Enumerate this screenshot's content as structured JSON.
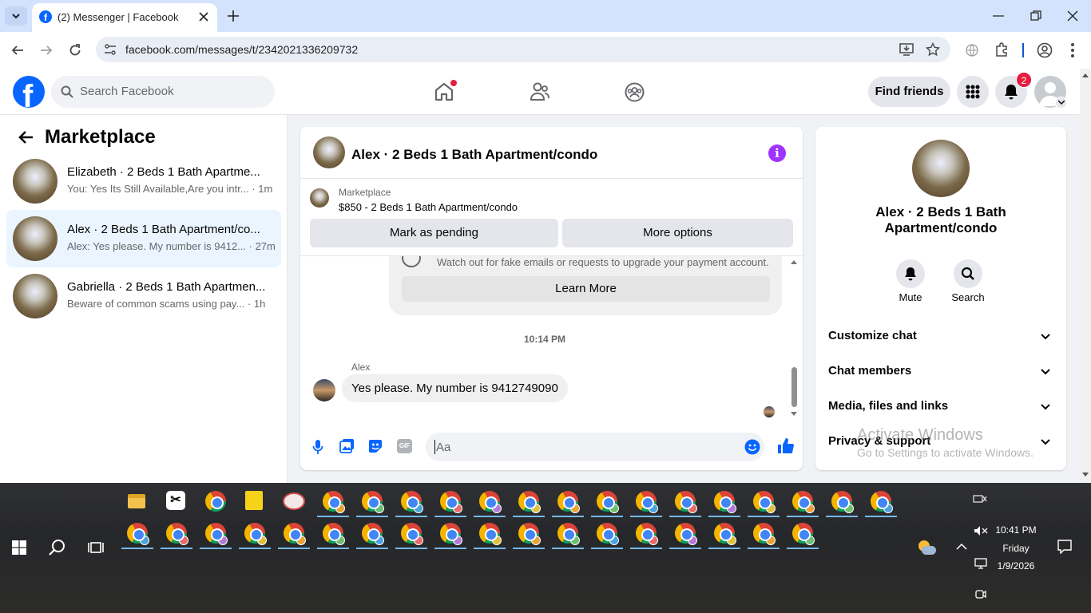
{
  "browser": {
    "tab_title": "(2) Messenger | Facebook",
    "url": "facebook.com/messages/t/2342021336209732"
  },
  "fb": {
    "search_placeholder": "Search Facebook",
    "find_friends": "Find friends",
    "notif_count": "2"
  },
  "left": {
    "title": "Marketplace",
    "conversations": [
      {
        "title": "Elizabeth · 2 Beds 1 Bath Apartme...",
        "snippet": "You: Yes Its Still Available,Are you intr...",
        "time": "· 1m"
      },
      {
        "title": "Alex · 2 Beds 1 Bath Apartment/co...",
        "snippet": "Alex: Yes please. My number is 9412...",
        "time": "· 27m"
      },
      {
        "title": "Gabriella · 2 Beds 1 Bath Apartmen...",
        "snippet": "Beware of common scams using pay...",
        "time": "· 1h"
      }
    ]
  },
  "chat": {
    "header_title": "Alex · 2 Beds 1 Bath Apartment/condo",
    "listing_label": "Marketplace",
    "listing_title": "$850 - 2 Beds 1 Bath Apartment/condo",
    "mark_pending": "Mark as pending",
    "more_options": "More options",
    "warning_text": "Watch out for fake emails or requests to upgrade your payment account.",
    "learn_more": "Learn More",
    "timestamp": "10:14 PM",
    "sender": "Alex",
    "message": "Yes please. My number is 9412749090",
    "composer_placeholder": "Aa",
    "gif_label": "GIF"
  },
  "info": {
    "name": "Alex · 2 Beds 1 Bath Apartment/condo",
    "mute": "Mute",
    "search": "Search",
    "sections": [
      "Customize chat",
      "Chat members",
      "Media, files and links",
      "Privacy & support"
    ]
  },
  "watermark": {
    "line1": "Activate Windows",
    "line2": "Go to Settings to activate Windows."
  },
  "taskbar": {
    "time": "10:41 PM",
    "day": "Friday",
    "date": "1/9/2026"
  },
  "colors": {
    "fb_blue": "#0866ff",
    "accent_purple": "#a033ff",
    "notif_red": "#e41e3f"
  }
}
